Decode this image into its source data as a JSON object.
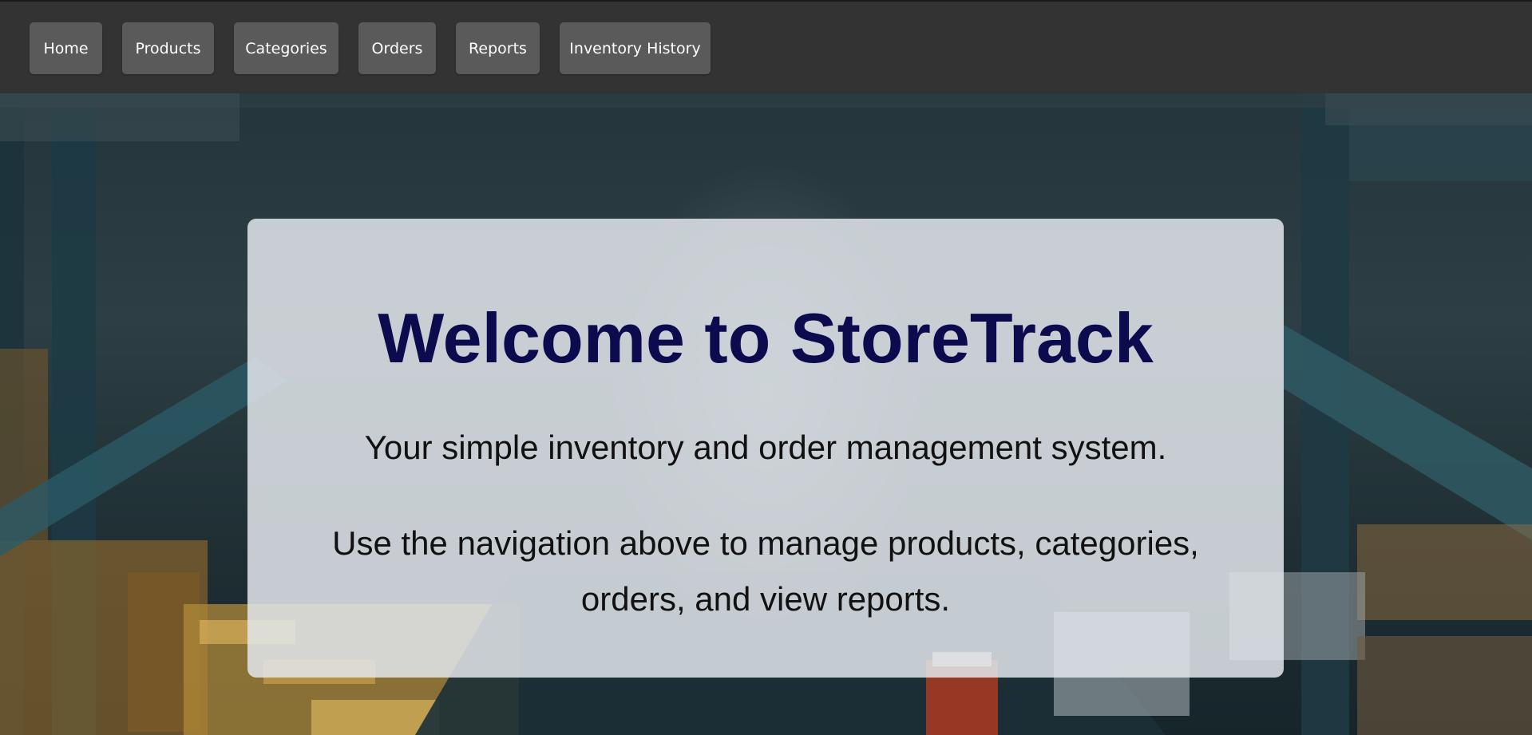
{
  "nav": {
    "items": [
      {
        "label": "Home"
      },
      {
        "label": "Products"
      },
      {
        "label": "Categories"
      },
      {
        "label": "Orders"
      },
      {
        "label": "Reports"
      },
      {
        "label": "Inventory History"
      }
    ]
  },
  "hero": {
    "title": "Welcome to StoreTrack",
    "subtitle": "Your simple inventory and order management system.",
    "description": "Use the navigation above to manage products, categories, orders, and view reports."
  },
  "colors": {
    "navbar": "#333333",
    "nav_button": "#5a5a5a",
    "title": "#0b0b4e",
    "card": "#e2e6eb"
  }
}
